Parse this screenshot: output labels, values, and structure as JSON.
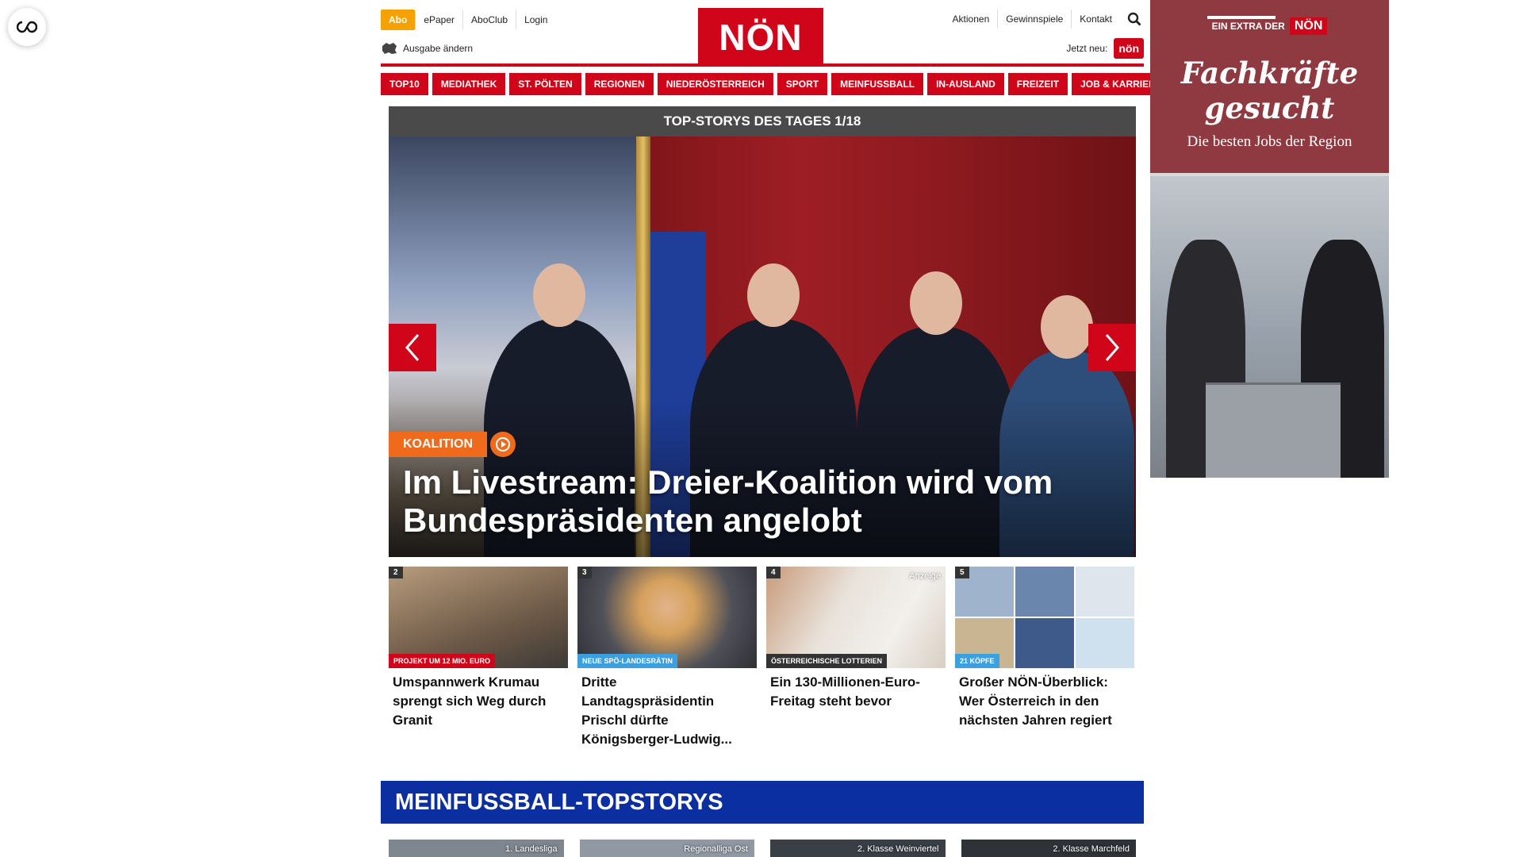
{
  "top": {
    "abo": "Abo",
    "links_left": [
      "ePaper",
      "AboClub",
      "Login"
    ],
    "ausgabe": "Ausgabe ändern",
    "logo": "NÖN",
    "links_right": [
      "Aktionen",
      "Gewinnspiele",
      "Kontakt"
    ],
    "jetzt_neu": "Jetzt neu:",
    "jetzt_logo": "nön"
  },
  "nav": [
    "TOP10",
    "MEDIATHEK",
    "ST. PÖLTEN",
    "REGIONEN",
    "NIEDERÖSTERREICH",
    "SPORT",
    "MEINFUSSBALL",
    "IN-AUSLAND",
    "FREIZEIT",
    "JOB & KARRIERE"
  ],
  "hero": {
    "header": "TOP-STORYS DES TAGES 1/18",
    "tag": "KOALITION",
    "title": "Im Livestream: Dreier-Koalition wird vom Bundespräsidenten angelobt"
  },
  "teasers": [
    {
      "num": "2",
      "badge": "PROJEKT UM 12 MIO. EURO",
      "badge_color": "#d0051a",
      "title": "Umspannwerk Krumau sprengt sich Weg durch Granit",
      "ad": ""
    },
    {
      "num": "3",
      "badge": "NEUE SPÖ-LANDESRÄTIN",
      "badge_color": "#3aa0e0",
      "title": "Dritte Landtagspräsidentin Prischl dürfte Königsberger-Ludwig...",
      "ad": ""
    },
    {
      "num": "4",
      "badge": "ÖSTERREICHISCHE LOTTERIEN",
      "badge_color": "#333333",
      "title": "Ein 130-Millionen-Euro-Freitag steht bevor",
      "ad": "Anzeige"
    },
    {
      "num": "5",
      "badge": "21 KÖPFE",
      "badge_color": "#3aa0e0",
      "title": "Großer NÖN-Überblick: Wer Österreich in den nächsten Jahren regiert",
      "ad": ""
    }
  ],
  "meinfussball": {
    "title": "MEINFUSSBALL-TOPSTORYS",
    "cards": [
      "1. Landesliga",
      "Regionalliga Ost",
      "2. Klasse Weinviertel",
      "2. Klasse Marchfeld"
    ]
  },
  "ad": {
    "extra": "EIN EXTRA DER",
    "brand": "NÖN",
    "headline_1": "Fachkräfte",
    "headline_2": "gesucht",
    "sub": "Die besten Jobs der Region"
  }
}
